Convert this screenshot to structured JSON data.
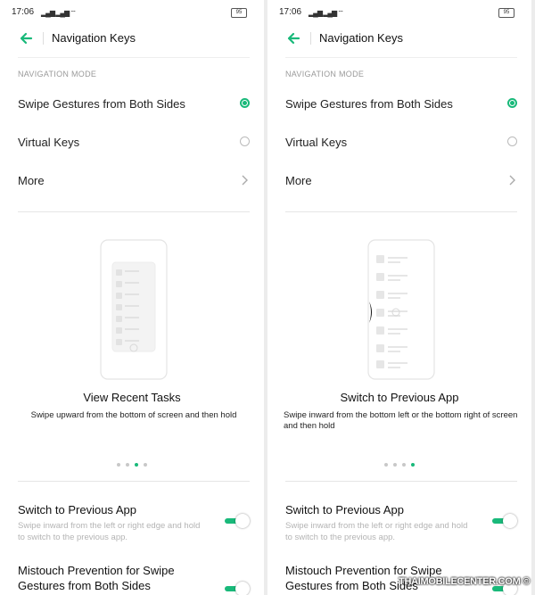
{
  "status": {
    "time": "17:06",
    "signal": "4G 4G WiFi VoLTE",
    "battery": "95"
  },
  "header": {
    "title": "Navigation Keys"
  },
  "section_label": "NAVIGATION MODE",
  "options": [
    {
      "label": "Swipe Gestures from Both Sides",
      "selected": true
    },
    {
      "label": "Virtual Keys",
      "selected": false
    },
    {
      "label": "More"
    }
  ],
  "left_card": {
    "title": "View Recent Tasks",
    "description": "Swipe upward from the bottom of screen and then hold",
    "active_dot": 3
  },
  "right_card": {
    "title": "Switch to Previous App",
    "description": "Swipe inward from the bottom left or the bottom right of screen and then hold",
    "active_dot": 4
  },
  "settings": [
    {
      "title": "Switch to Previous App",
      "description": "Swipe inward from the left or right edge and hold to switch to the previous app.",
      "enabled": true
    },
    {
      "title": "Mistouch Prevention for Swipe Gestures from Both Sides",
      "enabled": true
    }
  ],
  "watermark": "THAIMOBILECENTER.COM",
  "colors": {
    "accent": "#19b97a"
  }
}
